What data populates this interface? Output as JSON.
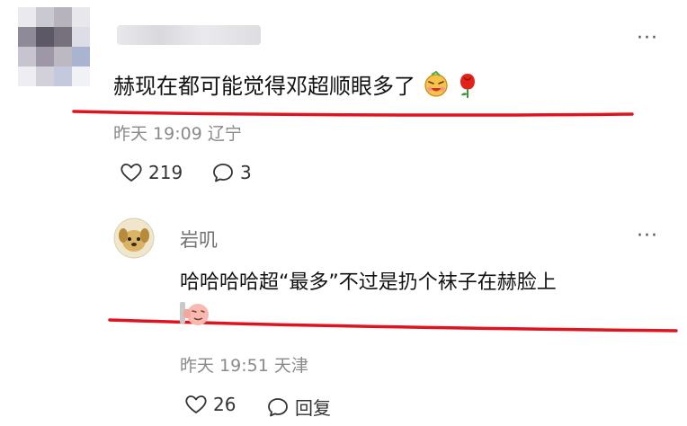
{
  "comment": {
    "text": "赫现在都可能觉得邓超顺眼多了",
    "time": "昨天 19:09",
    "location": "辽宁",
    "likes": "219",
    "replies": "3",
    "more": "···"
  },
  "reply": {
    "username": "岩叽",
    "text": "哈哈哈哈超“最多”不过是扔个袜子在赫脸上",
    "time": "昨天 19:51",
    "location": "天津",
    "likes": "26",
    "reply_label": "回复",
    "more": "···"
  },
  "colors": {
    "annotation_red": "#e0141e",
    "meta_gray": "#8a8a8a"
  }
}
